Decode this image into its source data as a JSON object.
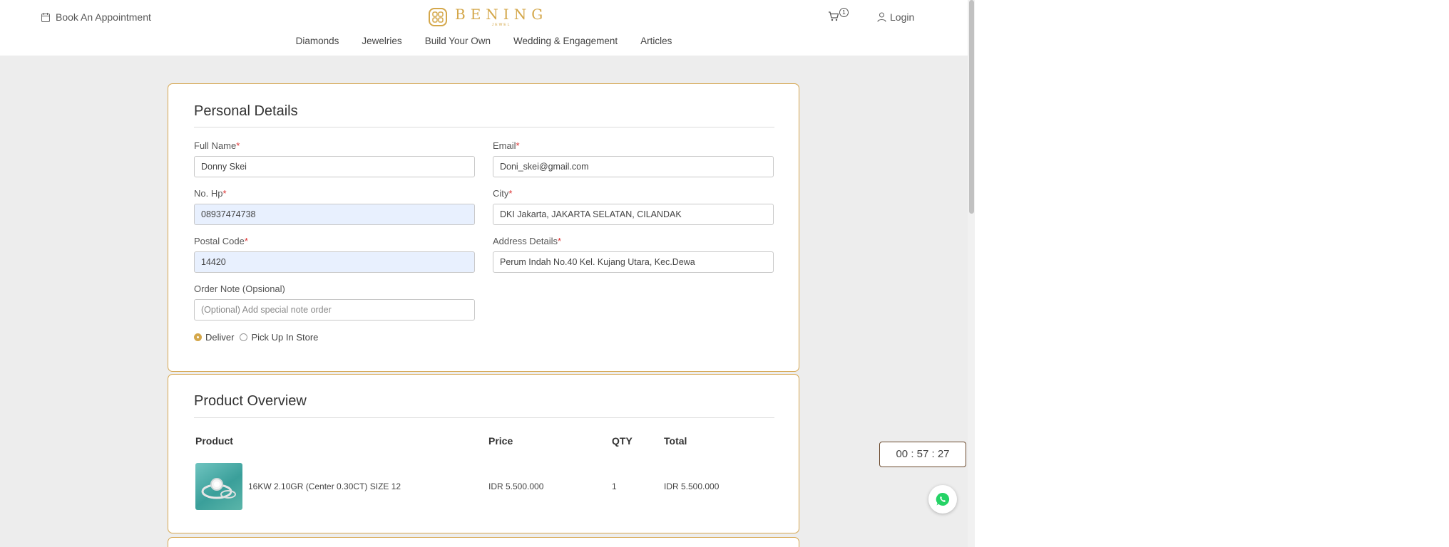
{
  "header": {
    "appointment_label": "Book An Appointment",
    "logo_text": "BENING",
    "logo_subtext": "JEWEL",
    "cart_count": "1",
    "login_label": "Login",
    "nav": [
      "Diamonds",
      "Jewelries",
      "Build Your Own",
      "Wedding & Engagement",
      "Articles"
    ]
  },
  "personal": {
    "title": "Personal Details",
    "full_name_label": "Full Name",
    "full_name_value": "Donny Skei",
    "email_label": "Email",
    "email_value": "Doni_skei@gmail.com",
    "phone_label": "No. Hp",
    "phone_value": "08937474738",
    "city_label": "City",
    "city_value": "DKI Jakarta, JAKARTA SELATAN, CILANDAK",
    "postal_label": "Postal Code",
    "postal_value": "14420",
    "address_label": "Address Details",
    "address_value": "Perum Indah No.40 Kel. Kujang Utara, Kec.Dewa",
    "note_label": "Order Note (Opsional)",
    "note_placeholder": "(Optional) Add special note order",
    "required_mark": "*",
    "delivery_options": [
      "Deliver",
      "Pick Up In Store"
    ],
    "delivery_selected": "Deliver"
  },
  "product": {
    "title": "Product Overview",
    "columns": [
      "Product",
      "Price",
      "QTY",
      "Total"
    ],
    "rows": [
      {
        "name": "16KW 2.10GR (Center 0.30CT) SIZE 12",
        "price": "IDR 5.500.000",
        "qty": "1",
        "total": "IDR 5.500.000"
      }
    ]
  },
  "timer": "00 : 57 : 27",
  "colors": {
    "accent": "#d4a74a",
    "border": "#d6a64f",
    "timer_border": "#6b4a2e",
    "whatsapp": "#25d366"
  }
}
